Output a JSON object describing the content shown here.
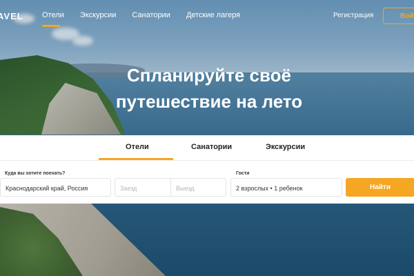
{
  "header": {
    "logo": "AVEL",
    "nav": [
      {
        "label": "Отели",
        "active": true
      },
      {
        "label": "Экскурсии",
        "active": false
      },
      {
        "label": "Санатории",
        "active": false
      },
      {
        "label": "Детские лагеря",
        "active": false
      }
    ],
    "register": "Регистрация",
    "login": "Войти"
  },
  "hero": {
    "title_line1": "Спланируйте своё",
    "title_line2": "путешествие на лето"
  },
  "search": {
    "tabs": [
      "Отели",
      "Санатории",
      "Экскурсии"
    ],
    "active_tab": "Отели",
    "destination_label": "Куда вы хотите поехать?",
    "destination_value": "Краснодарский край, Россия",
    "checkin_placeholder": "Заезд",
    "checkout_placeholder": "Выезд",
    "guests_label": "Гости",
    "guests_value": "2 взрослых • 1 ребенок",
    "submit": "Найти"
  },
  "colors": {
    "accent": "#f5a623"
  }
}
